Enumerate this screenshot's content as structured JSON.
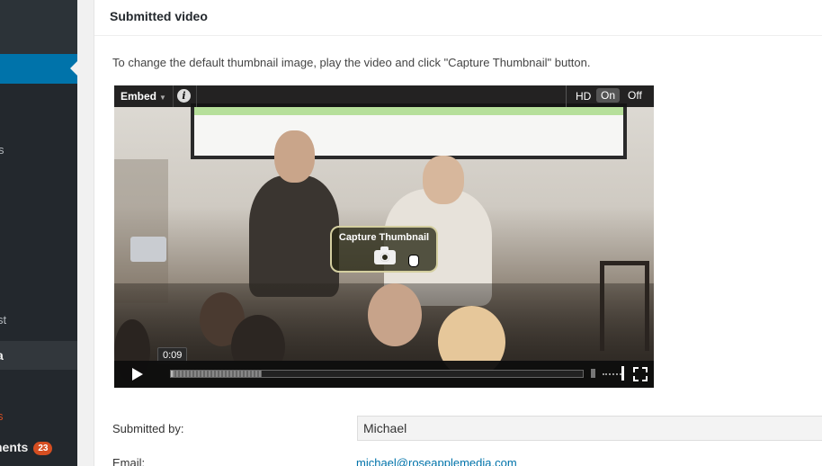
{
  "sidebar": {
    "fragments": [
      "s",
      "st",
      "a"
    ],
    "comments_label": "nents",
    "comments_count": "23"
  },
  "panel": {
    "title": "Submitted video",
    "instructions": "To change the default thumbnail image, play the video and click \"Capture Thumbnail\" button."
  },
  "player": {
    "embed_label": "Embed",
    "info_label": "i",
    "hd_label": "HD",
    "hd_on": "On",
    "hd_off": "Off",
    "capture_label": "Capture Thumbnail",
    "time_tooltip": "0:09",
    "progress_played": 0.005,
    "progress_buffered": 0.22
  },
  "form": {
    "submitted_by_label": "Submitted by:",
    "submitted_by_value": "Michael",
    "email_label": "Email:",
    "email_value": "michael@roseapplemedia.com"
  },
  "colors": {
    "sidebar_bg": "#23282d",
    "sidebar_active": "#0073aa",
    "badge": "#d54e21",
    "link": "#0073aa"
  }
}
